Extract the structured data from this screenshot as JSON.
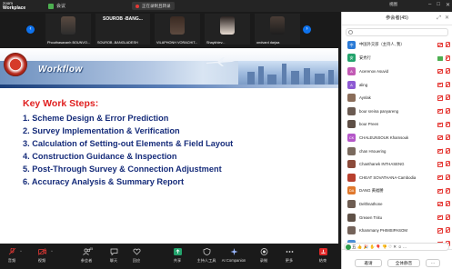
{
  "app": {
    "logo_line1": "zoom",
    "logo_line2": "Workplace",
    "meeting_label": "会议",
    "recording_label": "正在录制且转录",
    "view_label": "视图"
  },
  "gallery": {
    "tiles": [
      {
        "name": "Phouthasavanh BOUNVO..."
      },
      {
        "name": "SOUROB -BANGLADESH",
        "big_name": "SOUROB -BANG..."
      },
      {
        "name": "VILAPHONH VORACHIT..."
      },
      {
        "name": "Shaykhiev..."
      },
      {
        "name": "ondvard darjaa"
      }
    ]
  },
  "slide": {
    "title": "Workflow",
    "steps_heading": "Key Work Steps:",
    "steps": [
      "1. Scheme Design & Error Prediction",
      "2. Survey Implementation & Verification",
      "3. Calculation of Setting-out Elements & Field Layout",
      "4. Construction Guidance & Inspection",
      "5. Post-Through Survey & Connection Adjustment",
      "6. Accuracy Analysis & Summary Report"
    ]
  },
  "toolbar": {
    "items": [
      {
        "label": "音频",
        "icon": "mic-icon"
      },
      {
        "label": "视频",
        "icon": "video-icon"
      },
      {
        "label": "参会者",
        "icon": "participants-icon",
        "count": "45"
      },
      {
        "label": "聊天",
        "icon": "chat-icon"
      },
      {
        "label": "回应",
        "icon": "heart-icon"
      },
      {
        "label": "共享",
        "icon": "share-icon"
      },
      {
        "label": "主持人工具",
        "icon": "shield-icon"
      },
      {
        "label": "AI Companion",
        "icon": "sparkle-icon"
      },
      {
        "label": "录制",
        "icon": "record-icon"
      },
      {
        "label": "更多",
        "icon": "more-icon"
      },
      {
        "label": "结束",
        "icon": "end-icon"
      }
    ]
  },
  "panel": {
    "title": "参会者(45)",
    "search_placeholder": "",
    "participants": [
      {
        "name": "中国外交部（主持人, 我）",
        "avatar_text": "中",
        "avatar_color": "#2b7bd6",
        "mic": "off",
        "cam": "off"
      },
      {
        "name": "安秀行",
        "avatar_text": "安",
        "avatar_color": "#23a36c",
        "mic": "off",
        "cam": "on"
      },
      {
        "name": "Acerenov Asuvid",
        "avatar_text": "A",
        "avatar_color": "#c25ab4",
        "mic": "off",
        "cam": "off"
      },
      {
        "name": "aling",
        "avatar_text": "A",
        "avatar_color": "#8e5ad3",
        "mic": "off",
        "cam": "off"
      },
      {
        "name": "Aynlak",
        "avatar_text": "",
        "avatar_color": "#8a6d5a",
        "mic": "off",
        "cam": "off"
      },
      {
        "name": "bour sreina panyareng",
        "avatar_text": "",
        "avatar_color": "#6b5b52",
        "mic": "off",
        "cam": "off"
      },
      {
        "name": "bour Preen",
        "avatar_text": "",
        "avatar_color": "#5e4f46",
        "mic": "off",
        "cam": "off"
      },
      {
        "name": "CHALEUNSOUK Khamsouk",
        "avatar_text": "CK",
        "avatar_color": "#b557c9",
        "mic": "off",
        "cam": "off"
      },
      {
        "name": "chan Hrouering",
        "avatar_text": "",
        "avatar_color": "#7a6a5e",
        "mic": "off",
        "cam": "off"
      },
      {
        "name": "Chanthanek INTHASENG",
        "avatar_text": "",
        "avatar_color": "#8b4a3a",
        "mic": "off",
        "cam": "off"
      },
      {
        "name": "CHEAT SOVATHANA-Cambodia",
        "avatar_text": "",
        "avatar_color": "#b8402e",
        "mic": "off",
        "cam": "off"
      },
      {
        "name": "DANG 黄福勝",
        "avatar_text": "DA",
        "avatar_color": "#e0782c",
        "mic": "off",
        "cam": "off"
      },
      {
        "name": "Delthnathone",
        "avatar_text": "",
        "avatar_color": "#6e5d52",
        "mic": "off",
        "cam": "off"
      },
      {
        "name": "Greaen Tnitu",
        "avatar_text": "",
        "avatar_color": "#5f5147",
        "mic": "off",
        "cam": "off"
      },
      {
        "name": "Khammany PHIMSIPASOM",
        "avatar_text": "",
        "avatar_color": "#74635a",
        "mic": "off",
        "cam": "off"
      },
      {
        "name": "KI",
        "avatar_text": "KI",
        "avatar_color": "#4b8fd6",
        "mic": "off",
        "cam": "off"
      }
    ],
    "emoji_bar": "五  👍 🎉 ✋ 🎈 👎 ♡ ✕ ☺ ...",
    "invite_label": "邀请",
    "mute_all_label": "全体静音",
    "more_label": "···"
  }
}
